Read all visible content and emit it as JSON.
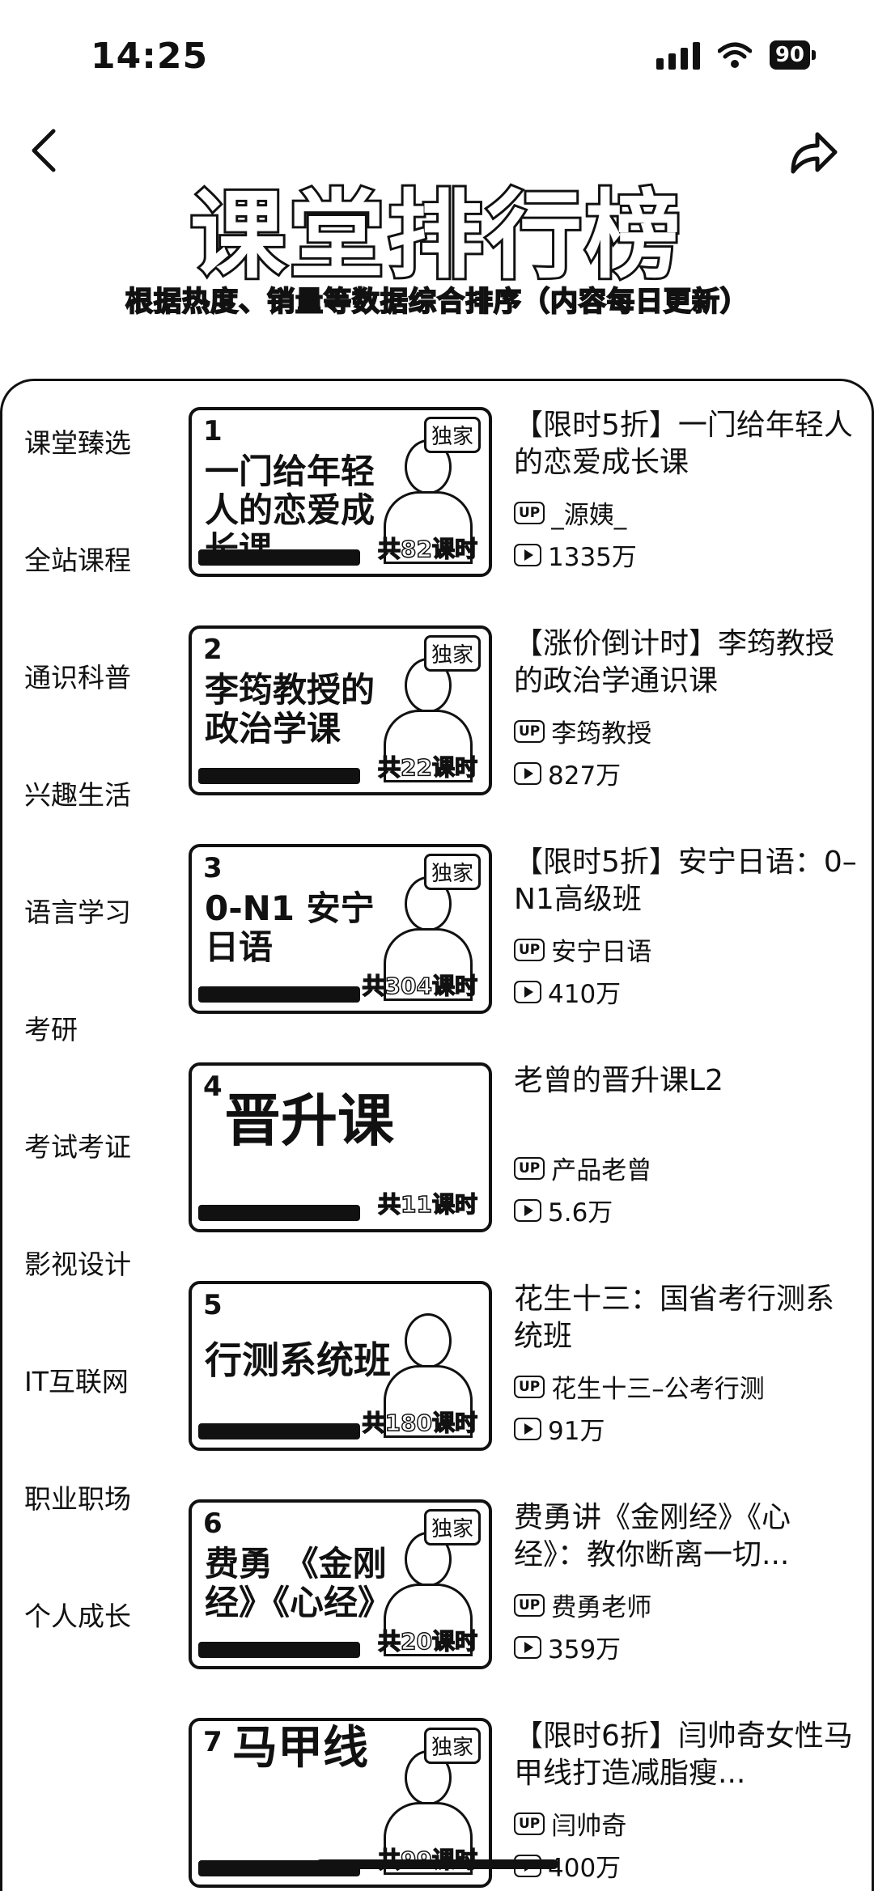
{
  "status": {
    "time": "14:25",
    "battery": "90"
  },
  "header": {
    "title": "课堂排行榜",
    "subtitle": "根据热度、销量等数据综合排序（内容每日更新）"
  },
  "categories": [
    "课堂臻选",
    "全站课程",
    "通识科普",
    "兴趣生活",
    "语言学习",
    "考研",
    "考试考证",
    "影视设计",
    "IT互联网",
    "职业职场",
    "个人成长"
  ],
  "courses": [
    {
      "rank": "1",
      "title": "【限时5折】一门给年轻人的恋爱成长课",
      "author": "_源姨_",
      "views": "1335万",
      "badge": "独家",
      "lessons": "共82课时",
      "thumb_text": "一门给年轻人的恋爱成长课"
    },
    {
      "rank": "2",
      "title": "【涨价倒计时】李筠教授的政治学通识课",
      "author": "李筠教授",
      "views": "827万",
      "badge": "独家",
      "lessons": "共22课时",
      "thumb_text": "李筠教授的政治学课"
    },
    {
      "rank": "3",
      "title": "【限时5折】安宁日语：0–N1高级班",
      "author": "安宁日语",
      "views": "410万",
      "badge": "独家",
      "lessons": "共304课时",
      "thumb_text": "0-N1 安宁日语"
    },
    {
      "rank": "4",
      "title": "老曾的晋升课L2",
      "author": "产品老曾",
      "views": "5.6万",
      "badge": "",
      "lessons": "共11课时",
      "thumb_text": "晋升课"
    },
    {
      "rank": "5",
      "title": "花生十三：国省考行测系统班",
      "author": "花生十三–公考行测",
      "views": "91万",
      "badge": "",
      "lessons": "共180课时",
      "thumb_text": "行测系统班"
    },
    {
      "rank": "6",
      "title": "费勇讲《金刚经》《心经》：教你断离一切...",
      "author": "费勇老师",
      "views": "359万",
      "badge": "独家",
      "lessons": "共20课时",
      "thumb_text": "费勇 《金刚经》《心经》"
    },
    {
      "rank": "7",
      "title": "【限时6折】闫帅奇女性马甲线打造减脂瘦...",
      "author": "闫帅奇",
      "views": "400万",
      "badge": "独家",
      "lessons": "共99课时",
      "thumb_text": "马甲线"
    }
  ]
}
